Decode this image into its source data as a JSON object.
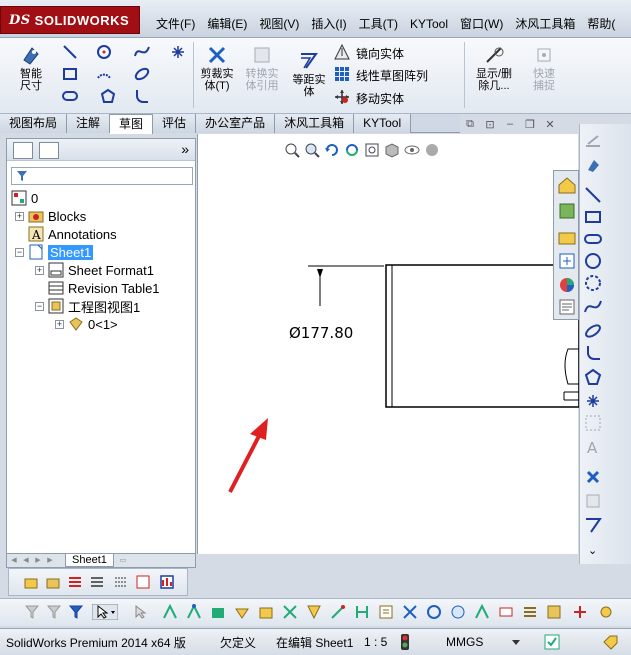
{
  "app": {
    "brand": "SOLIDWORKS",
    "brand_prefix": "DS"
  },
  "menu": [
    "文件(F)",
    "编辑(E)",
    "视图(V)",
    "插入(I)",
    "工具(T)",
    "KYTool",
    "窗口(W)",
    "沐风工具箱",
    "帮助("
  ],
  "ribbon": {
    "smart_dim": "智能尺寸",
    "trim": "剪裁实体(T)",
    "convert": "转换实体引用",
    "offset": "等距实体",
    "mirror": "镜向实体",
    "linear_pattern": "线性草图阵列",
    "move": "移动实体",
    "show_delete": "显示/删除几...",
    "quick_snap": "快速捕捉"
  },
  "tabs": [
    "视图布局",
    "注解",
    "草图",
    "评估",
    "办公室产品",
    "沐风工具箱",
    "KYTool"
  ],
  "active_tab": "草图",
  "tree": {
    "root": "0",
    "items": [
      "Blocks",
      "Annotations",
      "Sheet1",
      "Sheet Format1",
      "Revision Table1",
      "工程图视图1",
      "0<1>"
    ]
  },
  "sheet_tab": "Sheet1",
  "drawing": {
    "dimension": "Ø177.80"
  },
  "status": {
    "product": "SolidWorks Premium 2014 x64 版",
    "defined": "欠定义",
    "editing": "在编辑 Sheet1",
    "scale": "1 : 5",
    "units": "MMGS"
  },
  "colors": {
    "accent_red": "#a10f14",
    "arrow_red": "#e02020",
    "selection_blue": "#3399ff"
  }
}
